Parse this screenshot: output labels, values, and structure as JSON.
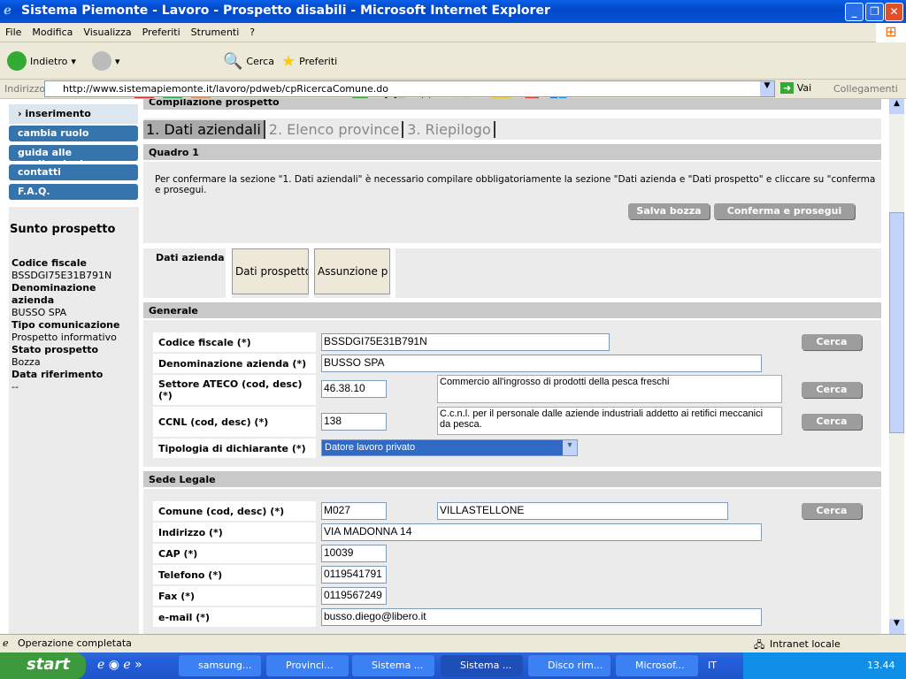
{
  "window": {
    "title": "Sistema Piemonte - Lavoro - Prospetto disabili - Microsoft Internet Explorer"
  },
  "menu": [
    "File",
    "Modifica",
    "Visualizza",
    "Preferiti",
    "Strumenti",
    "?"
  ],
  "toolbar": {
    "back": "Indietro",
    "search": "Cerca",
    "favorites": "Preferiti"
  },
  "address": {
    "label": "Indirizzo",
    "url": "http://www.sistemapiemonte.it/lavoro/pdweb/cpRicercaComune.do",
    "go": "Vai",
    "links": "Collegamenti"
  },
  "sidebar": {
    "current": "inserimento",
    "items": [
      "cambia ruolo",
      "guida alle applicazioni",
      "contatti",
      "F.A.Q."
    ],
    "summary_title": "Sunto prospetto",
    "summary": [
      {
        "k": "Codice fiscale",
        "v": "BSSDGI75E31B791N"
      },
      {
        "k": "Denominazione azienda",
        "v": "BUSSO SPA"
      },
      {
        "k": "Tipo comunicazione",
        "v": "Prospetto informativo"
      },
      {
        "k": "Stato prospetto",
        "v": "Bozza"
      },
      {
        "k": "Data riferimento",
        "v": "--"
      }
    ]
  },
  "main": {
    "header": "Compilazione prospetto",
    "steps": [
      "1. Dati aziendali",
      "2. Elenco province",
      "3. Riepilogo"
    ],
    "quadro": "Quadro 1",
    "info": "Per confermare la sezione \"1. Dati aziendali\" è necessario compilare obbligatoriamente la sezione \"Dati azienda e \"Dati prospetto\" e cliccare su \"conferma e prosegui.",
    "save": "Salva bozza",
    "confirm": "Conferma e prosegui",
    "subtabs": [
      "Dati azienda",
      "Dati prospetto",
      "Assunzione p"
    ],
    "generale": {
      "title": "Generale",
      "search": "Cerca",
      "cf_label": "Codice fiscale (*)",
      "cf": "BSSDGI75E31B791N",
      "den_label": "Denominazione azienda (*)",
      "den": "BUSSO SPA",
      "ateco_label": "Settore ATECO (cod, desc) (*)",
      "ateco_cod": "46.38.10",
      "ateco_desc": "Commercio all'ingrosso di prodotti della pesca freschi",
      "ccnl_label": "CCNL (cod, desc) (*)",
      "ccnl_cod": "138",
      "ccnl_desc": "C.c.n.l. per il personale dalle aziende industriali addetto ai retifici meccanici da pesca.",
      "tip_label": "Tipologia di dichiarante (*)",
      "tip": "Datore lavoro privato"
    },
    "sede": {
      "title": "Sede Legale",
      "comune_label": "Comune (cod, desc) (*)",
      "comune_cod": "M027",
      "comune_desc": "VILLASTELLONE",
      "ind_label": "Indirizzo (*)",
      "ind": "VIA MADONNA 14",
      "cap_label": "CAP (*)",
      "cap": "10039",
      "tel_label": "Telefono (*)",
      "tel": "0119541791",
      "fax_label": "Fax (*)",
      "fax": "0119567249",
      "email_label": "e-mail (*)",
      "email": "busso.diego@libero.it"
    }
  },
  "status": {
    "text": "Operazione completata",
    "zone": "Intranet locale"
  },
  "taskbar": {
    "start": "start",
    "tasks": [
      "samsung...",
      "Provinci...",
      "Sistema ...",
      "Sistema ...",
      "Disco rim...",
      "Microsof..."
    ],
    "lang": "IT",
    "clock": "13.44"
  }
}
